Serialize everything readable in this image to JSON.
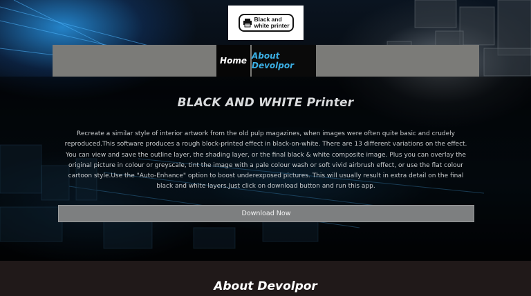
{
  "logo": {
    "text": "Black and\nwhite printer",
    "icon": "printer-icon"
  },
  "nav": {
    "items": [
      {
        "label": "Home",
        "active": true
      },
      {
        "label": "About Devolpor",
        "active": false
      }
    ],
    "colors": {
      "bar": "#7b7b78",
      "active_text": "#ffffff",
      "link_text": "#3bb0e6"
    }
  },
  "main": {
    "title": "BLACK AND WHITE Printer",
    "description": "Recreate a similar style of interior artwork from the old pulp magazines, when images were often quite basic and crudely reproduced.This software produces a rough block-printed effect in black-on-white. There are 13 different variations on the effect. You can view and save the outline layer, the shading layer, or the final black & white composite image. Plus you can overlay the original picture in colour or greyscale, tint the image with a pale colour wash or soft vivid airbrush effect, or use the flat colour cartoon style.Use the \"Auto-Enhance\" option to boost underexposed pictures. This will usually result in extra detail on the final black and white layers.Just click on download button and run this app.",
    "download_label": "Download Now"
  },
  "about": {
    "title": "About Devolpor"
  },
  "theme": {
    "accent": "#3bb0e6",
    "bottom_bg": "#201919"
  }
}
